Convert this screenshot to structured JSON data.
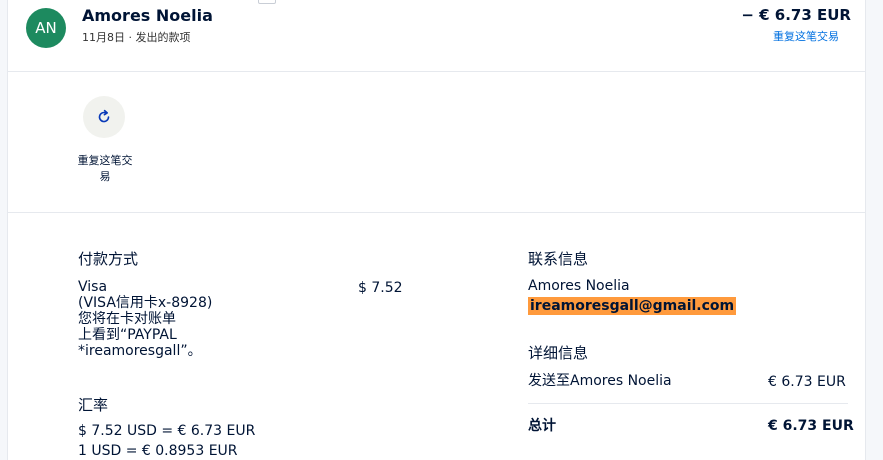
{
  "header": {
    "avatar_initials": "AN",
    "name": "Amores Noelia",
    "subtitle": "11月8日 · 发出的款项",
    "amount": "− € 6.73 EUR",
    "repeat_link": "重复这笔交易"
  },
  "actions": {
    "repeat_label_line1": "重复这笔交",
    "repeat_label_line2": "易"
  },
  "payment": {
    "title": "付款方式",
    "lines": [
      "Visa",
      "(VISA信用卡x-8928)",
      "您将在卡对账单",
      "上看到“PAYPAL",
      "*ireamoresgall”。"
    ],
    "amount": "$ 7.52"
  },
  "exchange": {
    "title": "汇率",
    "line1": "$ 7.52 USD = € 6.73 EUR",
    "line2": "1 USD = € 0.8953 EUR"
  },
  "contact": {
    "title": "联系信息",
    "name": "Amores Noelia",
    "email": "ireamoresgall@gmail.com"
  },
  "details": {
    "title": "详细信息",
    "sent_to": "发送至Amores Noelia",
    "sent_amount": "€ 6.73 EUR",
    "total_label": "总计",
    "total_amount": "€ 6.73 EUR"
  },
  "colors": {
    "avatar_bg": "#1d8a5f",
    "link": "#0070e0",
    "email_highlight": "#ff9a3c"
  },
  "icons": {
    "repeat": "refresh-icon"
  }
}
